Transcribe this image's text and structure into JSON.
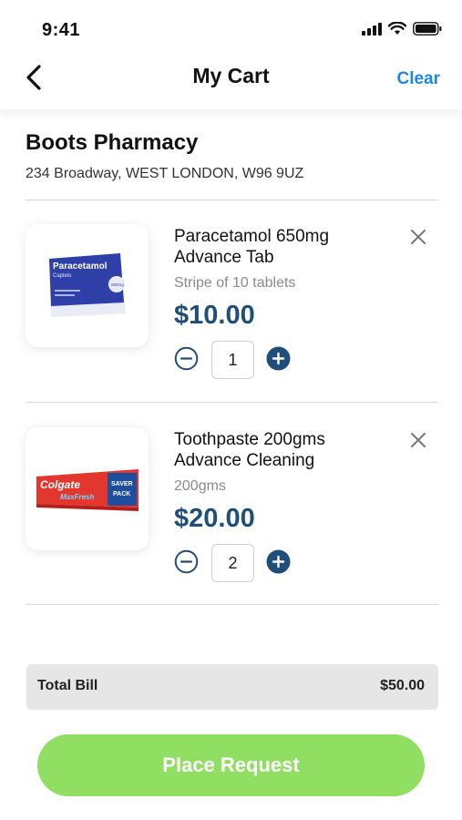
{
  "status_bar": {
    "time": "9:41",
    "icons": [
      "signal-icon",
      "wifi-icon",
      "battery-icon"
    ]
  },
  "header": {
    "title": "My Cart",
    "clear_label": "Clear",
    "back_icon": "chevron-left-icon"
  },
  "store": {
    "name": "Boots Pharmacy",
    "address": "234 Broadway, WEST LONDON, W96 9UZ"
  },
  "items": [
    {
      "name": "Paracetamol 650mg Advance Tab",
      "variant": "Stripe of 10 tablets",
      "price": "$10.00",
      "quantity": "1",
      "package_brand": "Paracetamol",
      "package_sub": "Caplets",
      "package_strength": "650mg"
    },
    {
      "name": "Toothpaste 200gms Advance Cleaning",
      "variant": "200gms",
      "price": "$20.00",
      "quantity": "2",
      "package_brand": "Colgate",
      "package_sub": "MaxFresh",
      "package_badge_line1": "SAVER",
      "package_badge_line2": "PACK"
    }
  ],
  "total": {
    "label": "Total Bill",
    "value": "$50.00"
  },
  "cta": {
    "label": "Place Request"
  },
  "colors": {
    "accent_blue": "#1e88e5",
    "price_navy": "#1f4e79",
    "cta_green": "#90df63",
    "total_bg": "#e6e6e6"
  }
}
